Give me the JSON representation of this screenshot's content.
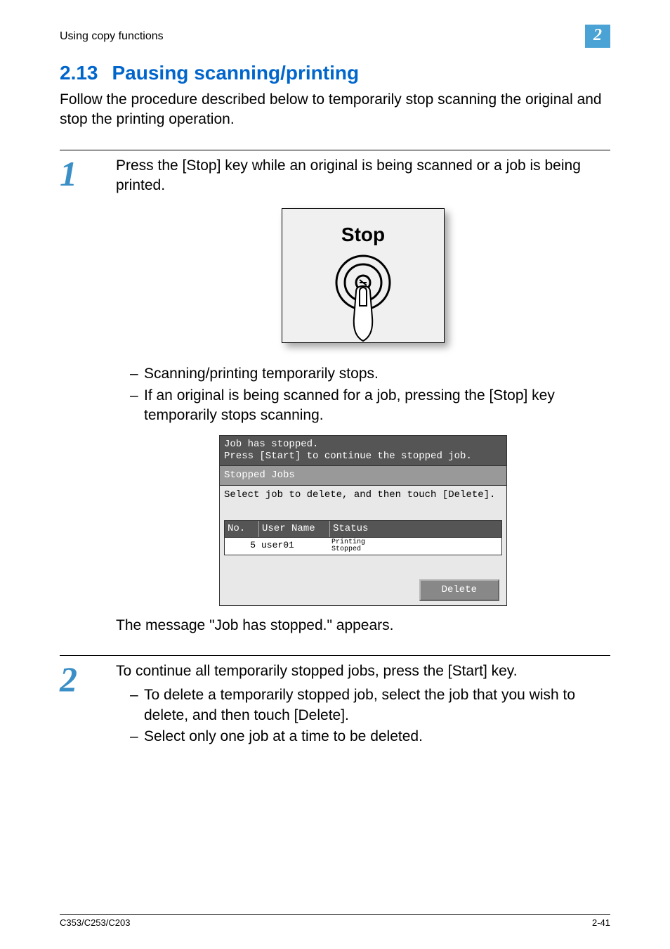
{
  "header": {
    "left": "Using copy functions",
    "chapter_number": "2"
  },
  "section": {
    "number": "2.13",
    "title": "Pausing scanning/printing",
    "intro": "Follow the procedure described below to temporarily stop scanning the original and stop the printing operation."
  },
  "step1": {
    "number": "1",
    "text": "Press the [Stop] key while an original is being scanned or a job is being printed.",
    "stop_label": "Stop",
    "bullets": [
      "Scanning/printing temporarily stops.",
      "If an original is being scanned for a job, pressing the [Stop] key temporarily stops scanning."
    ],
    "screen": {
      "line1": "Job has stopped.",
      "line2": "Press [Start] to continue the stopped job.",
      "section_label": "Stopped Jobs",
      "instruction": "Select job to delete, and then touch [Delete].",
      "cols": {
        "no": "No.",
        "user": "User Name",
        "status": "Status"
      },
      "row": {
        "no": "5",
        "user": "user01",
        "status1": "Printing",
        "status2": "Stopped"
      },
      "delete_label": "Delete"
    },
    "post_message": "The message \"Job has stopped.\" appears."
  },
  "step2": {
    "number": "2",
    "text": "To continue all temporarily stopped jobs, press the [Start] key.",
    "bullets": [
      "To delete a temporarily stopped job, select the job that you wish to delete, and then touch [Delete].",
      "Select only one job at a time to be deleted."
    ]
  },
  "footer": {
    "model": "C353/C253/C203",
    "page": "2-41"
  }
}
